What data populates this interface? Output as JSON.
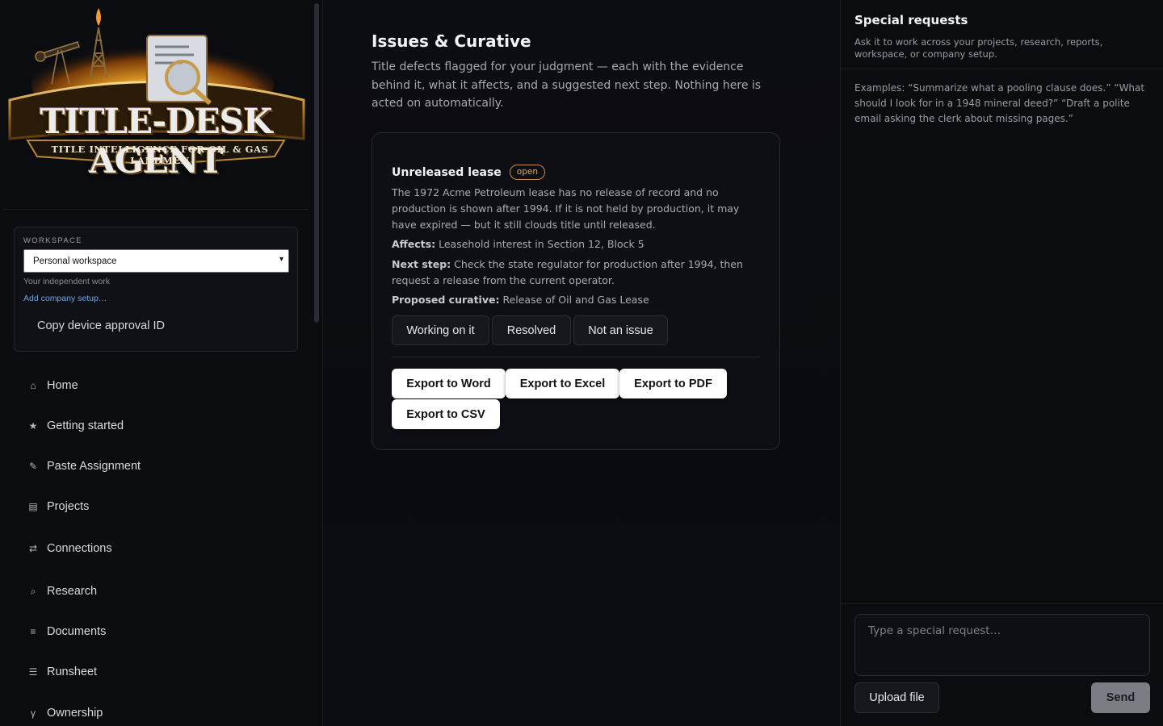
{
  "brand": {
    "title": "TITLE-DESK AGENT",
    "subtitle": "TITLE INTELLIGENCE FOR OIL & GAS LANDMEN"
  },
  "workspace": {
    "label": "WORKSPACE",
    "selected": "Personal workspace",
    "note": "Your independent work",
    "link": "Add company setup…",
    "copy_label": "Copy device approval ID"
  },
  "nav": [
    {
      "icon": "home-icon",
      "glyph": "⌂",
      "label": "Home"
    },
    {
      "icon": "star-icon",
      "glyph": "★",
      "label": "Getting started"
    },
    {
      "icon": "pencil-icon",
      "glyph": "✎",
      "label": "Paste Assignment"
    },
    {
      "icon": "folder-icon",
      "glyph": "▤",
      "label": "Projects"
    },
    {
      "icon": "swap-icon",
      "glyph": "⇄",
      "label": "Connections"
    },
    {
      "icon": "search-icon",
      "glyph": "⌕",
      "label": "Research"
    },
    {
      "icon": "documents-icon",
      "glyph": "≡",
      "label": "Documents"
    },
    {
      "icon": "list-icon",
      "glyph": "☰",
      "label": "Runsheet"
    },
    {
      "icon": "ownership-icon",
      "glyph": "γ",
      "label": "Ownership"
    }
  ],
  "main": {
    "title": "Issues & Curative",
    "description": "Title defects flagged for your judgment — each with the evidence behind it, what it affects, and a suggested next step. Nothing here is acted on automatically.",
    "issue": {
      "title": "Unreleased lease",
      "status": "open",
      "body": "The 1972 Acme Petroleum lease has no release of record and no production is shown after 1994. If it is not held by production, it may have expired — but it still clouds title until released.",
      "affects_label": "Affects:",
      "affects": "Leasehold interest in Section 12, Block 5",
      "next_label": "Next step:",
      "next": "Check the state regulator for production after 1994, then request a release from the current operator.",
      "curative_label": "Proposed curative:",
      "curative": "Release of Oil and Gas Lease",
      "status_buttons": [
        "Working on it",
        "Resolved",
        "Not an issue"
      ],
      "export_buttons": [
        "Export to Word",
        "Export to Excel",
        "Export to PDF",
        "Export to CSV"
      ]
    }
  },
  "special": {
    "title": "Special requests",
    "subtitle": "Ask it to work across your projects, research, reports, workspace, or company setup.",
    "examples": "Examples: “Summarize what a pooling clause does.” “What should I look for in a 1948 mineral deed?” “Draft a polite email asking the clerk about missing pages.”",
    "placeholder": "Type a special request…",
    "upload_label": "Upload file",
    "send_label": "Send"
  }
}
